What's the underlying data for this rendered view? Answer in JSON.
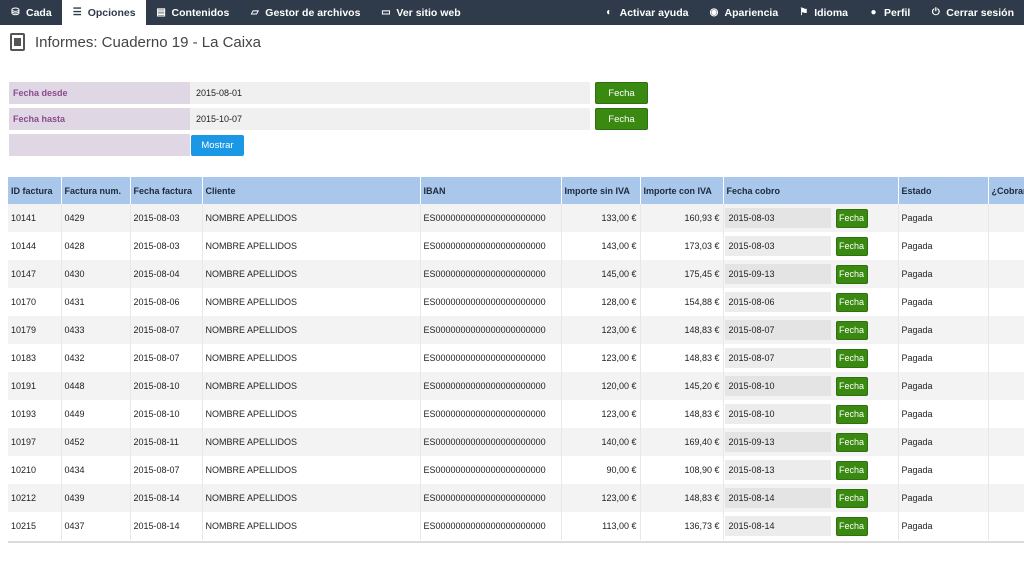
{
  "nav": {
    "left": [
      {
        "label": "Cada",
        "icon": "database-icon",
        "active": false
      },
      {
        "label": "Opciones",
        "icon": "menu-icon",
        "active": true
      },
      {
        "label": "Contenidos",
        "icon": "list-icon",
        "active": false
      },
      {
        "label": "Gestor de archivos",
        "icon": "folder-icon",
        "active": false
      },
      {
        "label": "Ver sitio web",
        "icon": "monitor-icon",
        "active": false
      }
    ],
    "right": [
      {
        "label": "Activar ayuda",
        "icon": "toggle-icon"
      },
      {
        "label": "Apariencia",
        "icon": "eye-icon"
      },
      {
        "label": "Idioma",
        "icon": "flag-icon"
      },
      {
        "label": "Perfil",
        "icon": "user-icon"
      },
      {
        "label": "Cerrar sesión",
        "icon": "power-icon"
      }
    ]
  },
  "page": {
    "title": "Informes: Cuaderno 19 - La Caixa"
  },
  "form": {
    "desde_label": "Fecha desde",
    "desde_value": "2015-08-01",
    "hasta_label": "Fecha hasta",
    "hasta_value": "2015-10-07",
    "fecha_button": "Fecha",
    "mostrar_button": "Mostrar"
  },
  "table": {
    "headers": [
      "ID factura",
      "Factura num.",
      "Fecha factura",
      "Cliente",
      "IBAN",
      "Importe sin IVA",
      "Importe con IVA",
      "Fecha cobro",
      "Estado",
      "¿Cobrar"
    ],
    "row_button": "Fecha",
    "rows": [
      {
        "id": "10141",
        "num": "0429",
        "fecha": "2015-08-03",
        "cliente": "NOMBRE APELLIDOS",
        "iban": "ES0000000000000000000000",
        "sin_iva": "133,00 €",
        "con_iva": "160,93 €",
        "cobro": "2015-08-03",
        "estado": "Pagada"
      },
      {
        "id": "10144",
        "num": "0428",
        "fecha": "2015-08-03",
        "cliente": "NOMBRE APELLIDOS",
        "iban": "ES0000000000000000000000",
        "sin_iva": "143,00 €",
        "con_iva": "173,03 €",
        "cobro": "2015-08-03",
        "estado": "Pagada"
      },
      {
        "id": "10147",
        "num": "0430",
        "fecha": "2015-08-04",
        "cliente": "NOMBRE APELLIDOS",
        "iban": "ES0000000000000000000000",
        "sin_iva": "145,00 €",
        "con_iva": "175,45 €",
        "cobro": "2015-09-13",
        "estado": "Pagada"
      },
      {
        "id": "10170",
        "num": "0431",
        "fecha": "2015-08-06",
        "cliente": "NOMBRE APELLIDOS",
        "iban": "ES0000000000000000000000",
        "sin_iva": "128,00 €",
        "con_iva": "154,88 €",
        "cobro": "2015-08-06",
        "estado": "Pagada"
      },
      {
        "id": "10179",
        "num": "0433",
        "fecha": "2015-08-07",
        "cliente": "NOMBRE APELLIDOS",
        "iban": "ES0000000000000000000000",
        "sin_iva": "123,00 €",
        "con_iva": "148,83 €",
        "cobro": "2015-08-07",
        "estado": "Pagada"
      },
      {
        "id": "10183",
        "num": "0432",
        "fecha": "2015-08-07",
        "cliente": "NOMBRE APELLIDOS",
        "iban": "ES0000000000000000000000",
        "sin_iva": "123,00 €",
        "con_iva": "148,83 €",
        "cobro": "2015-08-07",
        "estado": "Pagada"
      },
      {
        "id": "10191",
        "num": "0448",
        "fecha": "2015-08-10",
        "cliente": "NOMBRE APELLIDOS",
        "iban": "ES0000000000000000000000",
        "sin_iva": "120,00 €",
        "con_iva": "145,20 €",
        "cobro": "2015-08-10",
        "estado": "Pagada"
      },
      {
        "id": "10193",
        "num": "0449",
        "fecha": "2015-08-10",
        "cliente": "NOMBRE APELLIDOS",
        "iban": "ES0000000000000000000000",
        "sin_iva": "123,00 €",
        "con_iva": "148,83 €",
        "cobro": "2015-08-10",
        "estado": "Pagada"
      },
      {
        "id": "10197",
        "num": "0452",
        "fecha": "2015-08-11",
        "cliente": "NOMBRE APELLIDOS",
        "iban": "ES0000000000000000000000",
        "sin_iva": "140,00 €",
        "con_iva": "169,40 €",
        "cobro": "2015-09-13",
        "estado": "Pagada"
      },
      {
        "id": "10210",
        "num": "0434",
        "fecha": "2015-08-07",
        "cliente": "NOMBRE APELLIDOS",
        "iban": "ES0000000000000000000000",
        "sin_iva": "90,00 €",
        "con_iva": "108,90 €",
        "cobro": "2015-08-13",
        "estado": "Pagada"
      },
      {
        "id": "10212",
        "num": "0439",
        "fecha": "2015-08-14",
        "cliente": "NOMBRE APELLIDOS",
        "iban": "ES0000000000000000000000",
        "sin_iva": "123,00 €",
        "con_iva": "148,83 €",
        "cobro": "2015-08-14",
        "estado": "Pagada"
      },
      {
        "id": "10215",
        "num": "0437",
        "fecha": "2015-08-14",
        "cliente": "NOMBRE APELLIDOS",
        "iban": "ES0000000000000000000000",
        "sin_iva": "113,00 €",
        "con_iva": "136,73 €",
        "cobro": "2015-08-14",
        "estado": "Pagada"
      }
    ]
  }
}
